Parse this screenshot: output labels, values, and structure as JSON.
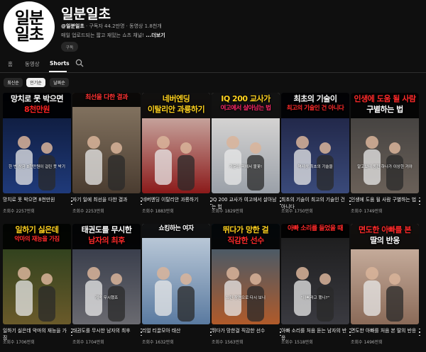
{
  "channel": {
    "avatar_text": [
      "일분",
      "일초"
    ],
    "name": "일분일초",
    "handle": "@일분일초",
    "meta": "· 구독자 44.2만명 · 동영상 1.8천개",
    "description": "매일 업로드되는 짧고 재밌는 쇼츠 채널!",
    "more": "...더보기",
    "subscribe_label": "구독"
  },
  "tabs": [
    {
      "label": "홈"
    },
    {
      "label": "동영상"
    },
    {
      "label": "Shorts"
    }
  ],
  "sort_chips": [
    {
      "label": "최신순"
    },
    {
      "label": "인기순"
    },
    {
      "label": "날짜순"
    }
  ],
  "videos": [
    {
      "caption_lines": [
        "망치로 못 박으면",
        "8천만원"
      ],
      "caption_colors": [
        "#ffffff",
        "#ff2222"
      ],
      "overlay": "한 번 상금 8천만원이 걸린 못 박기",
      "title": "망치로 못 박으면 8천만원",
      "views": "조회수 2257만회",
      "bg": [
        "#0b1530",
        "#1f3a7a"
      ]
    },
    {
      "caption_lines": [
        "최선을 다한 결과"
      ],
      "caption_colors": [
        "#ff3333"
      ],
      "overlay": "",
      "title": "자기 일에 최선을 다한 결과",
      "views": "조회수 2253만회",
      "bg": [
        "#8a7a66",
        "#4a3c30"
      ]
    },
    {
      "caption_lines": [
        "네버엔딩",
        "이탈리안 과룡하기"
      ],
      "caption_colors": [
        "#ffd21f",
        "#ffd21f"
      ],
      "overlay": "",
      "title": "네버엔딩 이탈리안 과룡하기",
      "views": "조회수 1883만회",
      "bg": [
        "#d9cfc6",
        "#8b1a1a"
      ]
    },
    {
      "caption_lines": [
        "IQ 200 교사가",
        "여고에서 살아남는 법"
      ],
      "caption_colors": [
        "#ffd21f",
        "#ff2a6a"
      ],
      "overlay": "가문의 피에서 불꽃!",
      "title": "IQ 200 교사가 여고에서 살아남는 법",
      "views": "조회수 1829만회",
      "bg": [
        "#e8e4e0",
        "#9aa0a8"
      ]
    },
    {
      "caption_lines": [
        "최초의 기술이",
        "최고의 기술인 건 아니다"
      ],
      "caption_colors": [
        "#ffffff",
        "#ff2a2a"
      ],
      "overlay": "역사상 최초의 기술을",
      "title": "최초의 기술이 최고의 기술인 건 아니다",
      "views": "조회수 1750만회",
      "bg": [
        "#1a1d3a",
        "#3a4a7a"
      ]
    },
    {
      "caption_lines": [
        "인생에 도움 될 사람",
        "구별하는 법"
      ],
      "caption_colors": [
        "#ff2a2a",
        "#ffffff"
      ],
      "overlay": "알고보니 동전 하나가 이상한 거야",
      "title": "인생에 도움 될 사람 구별하는 법",
      "views": "조회수 1749만회",
      "bg": [
        "#3a3a3a",
        "#6a6058"
      ]
    },
    {
      "caption_lines": [
        "일하기 싫은데",
        "악마의 재능을 가짐"
      ],
      "caption_colors": [
        "#ffd21f",
        "#ff2a2a"
      ],
      "overlay": "",
      "title": "일하기 싫은데 악마의 재능을 가짐",
      "views": "조회수 1706만회",
      "bg": [
        "#1f3a1a",
        "#6a5a2a"
      ]
    },
    {
      "caption_lines": [
        "태권도를 무시한",
        "남자의 최후"
      ],
      "caption_colors": [
        "#ffffff",
        "#ff2a2a"
      ],
      "overlay": "계속 무시했죠",
      "title": "태권도를 무시한 남자의 최후",
      "views": "조회수 1704만회",
      "bg": [
        "#2a3040",
        "#6a6a70"
      ]
    },
    {
      "caption_lines": [
        "쇼킹하는 여자"
      ],
      "caption_colors": [
        "#ffffff"
      ],
      "overlay": "",
      "title": "리얼 티끌모아 태산",
      "views": "조회수 1632만회",
      "bg": [
        "#c8d4e0",
        "#5a7aa0"
      ]
    },
    {
      "caption_lines": [
        "뛰다가 망한 걸",
        "직감한 선수"
      ],
      "caption_colors": [
        "#ffd21f",
        "#ff2a2a"
      ],
      "overlay": "느린 장면으로 다시 보니",
      "title": "뛰다가 망한걸 직감한 선수",
      "views": "조회수 1563만회",
      "bg": [
        "#2a5a7a",
        "#b05a2a"
      ]
    },
    {
      "caption_lines": [
        "아빠 소리를 들었을 때"
      ],
      "caption_colors": [
        "#ff2a2a"
      ],
      "overlay": "\"아빠라고 했니?\"",
      "title": "아빠 소리를 처음 듣는 남자의 반응",
      "views": "조회수 1518만회",
      "bg": [
        "#1a1a1a",
        "#3a3a40"
      ]
    },
    {
      "caption_lines": [
        "면도한 아빠를 본",
        "딸의 반응"
      ],
      "caption_colors": [
        "#ff2a2a",
        "#ffffff"
      ],
      "overlay": "",
      "title": "면도한 아빠를 처음 본 딸의 반응",
      "views": "조회수 1496만회",
      "bg": [
        "#d8c0b0",
        "#8a6a58"
      ]
    }
  ],
  "colors": {
    "background": "#0f0f0f",
    "text": "#f1f1f1",
    "secondary": "#aaaaaa",
    "chip": "#272727"
  }
}
